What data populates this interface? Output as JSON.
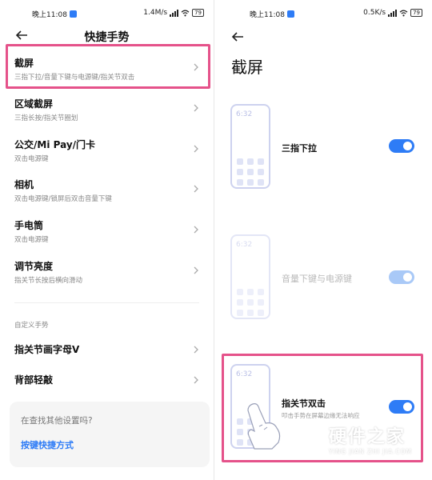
{
  "left": {
    "status": {
      "time": "晚上11:08",
      "speed": "1.4M/s",
      "battery": "79"
    },
    "title": "快捷手势",
    "items": [
      {
        "title": "截屏",
        "subtitle": "三指下拉/音量下键与电源键/指关节双击"
      },
      {
        "title": "区域截屏",
        "subtitle": "三指长按/指关节圈划"
      },
      {
        "title": "公交/Mi Pay/门卡",
        "subtitle": "双击电源键"
      },
      {
        "title": "相机",
        "subtitle": "双击电源键/锁屏后双击音量下键"
      },
      {
        "title": "手电筒",
        "subtitle": "双击电源键"
      },
      {
        "title": "调节亮度",
        "subtitle": "指关节长按后横向滑动"
      }
    ],
    "section_label": "自定义手势",
    "custom_items": [
      {
        "title": "指关节画字母V"
      },
      {
        "title": "背部轻敲"
      }
    ],
    "card": {
      "question": "在查找其他设置吗?",
      "link": "按键快捷方式"
    }
  },
  "right": {
    "status": {
      "time": "晚上11:08",
      "speed": "0.5K/s",
      "battery": "79"
    },
    "title": "截屏",
    "options": [
      {
        "preview_time": "6:32",
        "label": "三指下拉",
        "subtitle": "",
        "enabled": true,
        "dimmed": false
      },
      {
        "preview_time": "6:32",
        "label": "音量下键与电源键",
        "subtitle": "",
        "enabled": true,
        "dimmed": true
      },
      {
        "preview_time": "6:32",
        "label": "指关节双击",
        "subtitle": "叩击手势在屏幕边缘无法响应",
        "enabled": true,
        "dimmed": false
      }
    ]
  },
  "watermark": {
    "cn": "硬件之家",
    "en": "YING JIAN ZHI JIA.COM"
  },
  "colors": {
    "accent": "#2e7cf6",
    "highlight": "#e5528a",
    "toggle_disabled": "#a9c9f7"
  },
  "icons": [
    "back-arrow-icon",
    "chevron-right-icon",
    "signal-icon",
    "wifi-icon",
    "battery-icon",
    "notification-icon",
    "hand-tap-icon"
  ]
}
